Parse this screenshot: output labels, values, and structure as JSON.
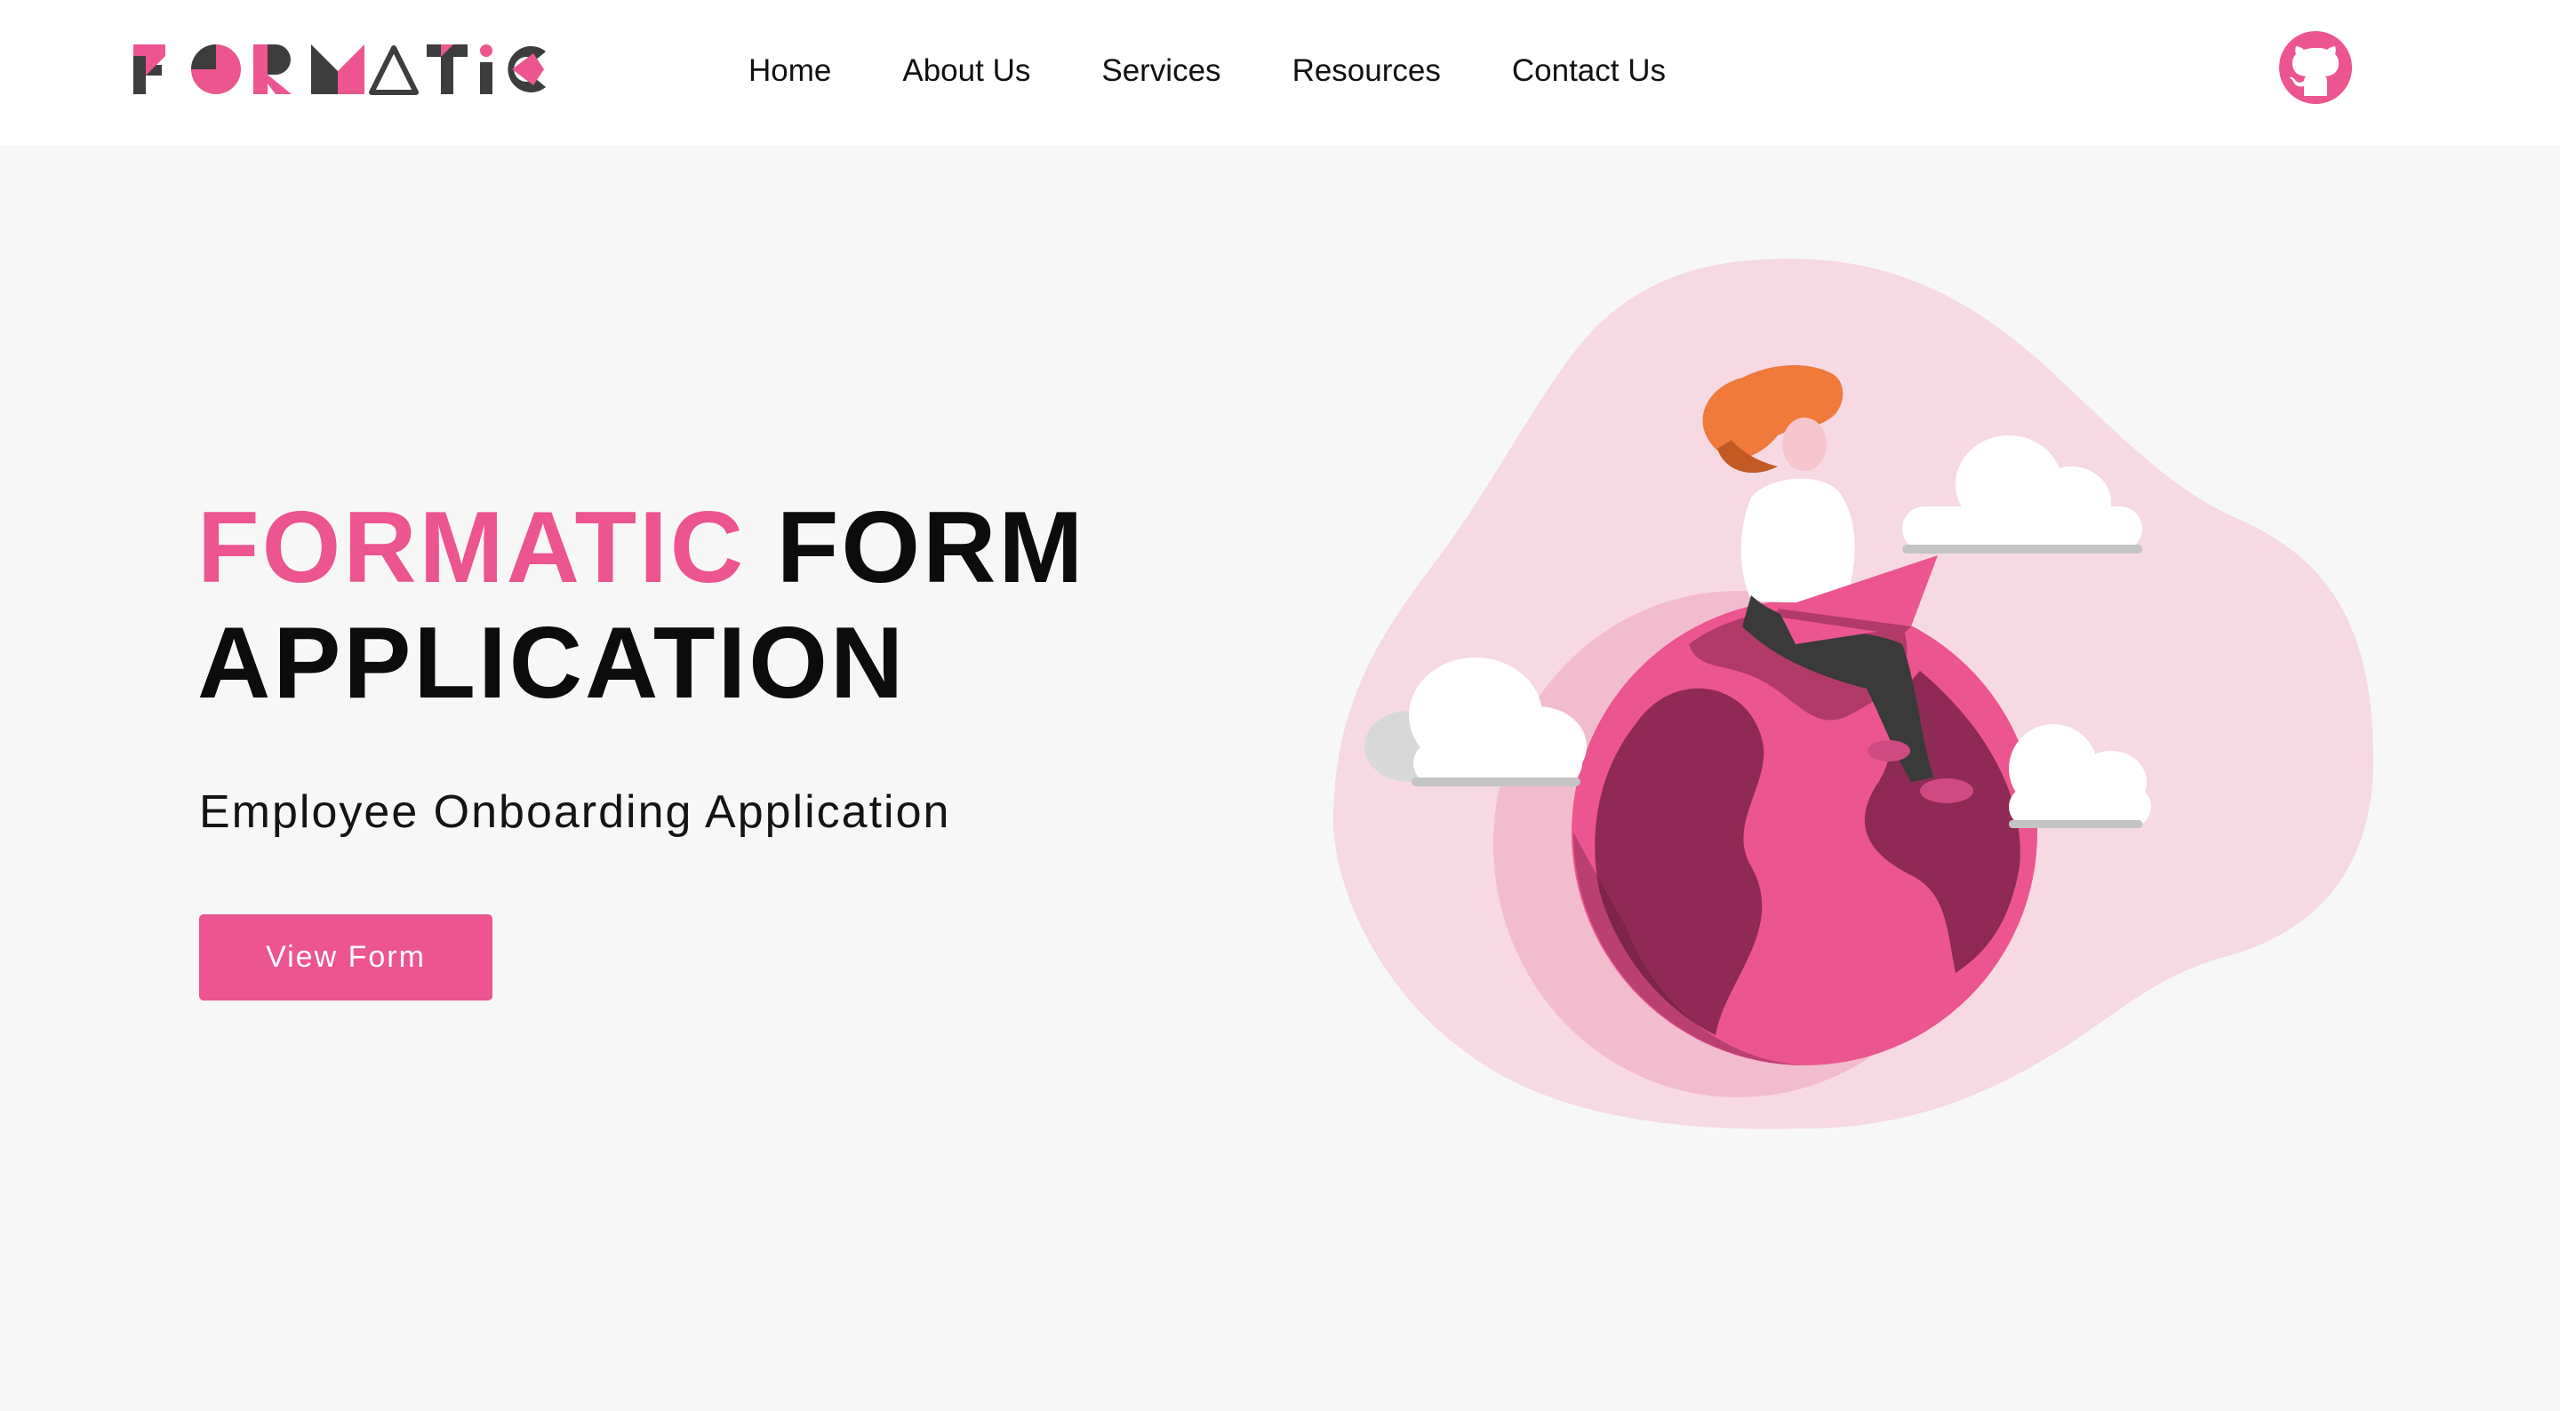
{
  "brand": {
    "logo_text": "FORMATIC",
    "colors": {
      "accent": "#ec5590",
      "dark": "#3d3d3d",
      "light_pink": "#f6d9e3"
    }
  },
  "nav": {
    "items": [
      {
        "label": "Home"
      },
      {
        "label": "About Us"
      },
      {
        "label": "Services"
      },
      {
        "label": "Resources"
      },
      {
        "label": "Contact Us"
      }
    ]
  },
  "header": {
    "github_icon": "github-icon"
  },
  "hero": {
    "title_accent": "FORMATIC",
    "title_rest": "FORM",
    "title_line2": "APPLICATION",
    "subtitle": "Employee Onboarding Application",
    "cta_label": "View Form"
  }
}
